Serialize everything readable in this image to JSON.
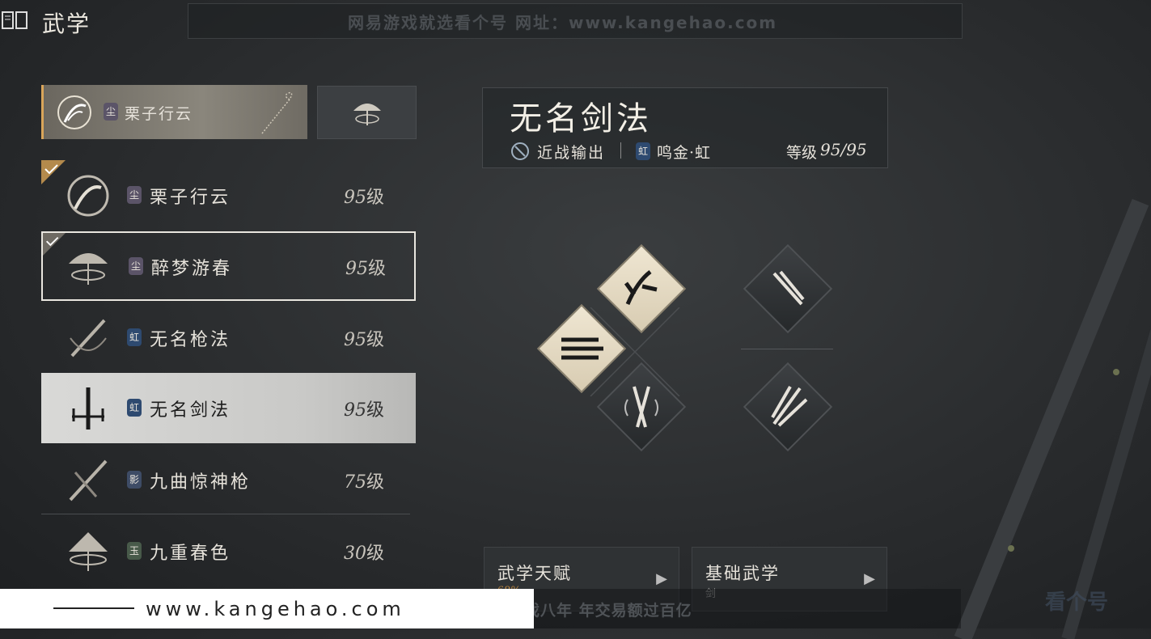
{
  "header": {
    "title": "武学",
    "icon": "book-icon"
  },
  "watermark": {
    "top_banner": "网易游戏就选看个号  网址：www.kangehao.com",
    "footer_url": "www.kangehao.com",
    "footer_text": "看个号专业网易游戏八年  年交易额过百亿",
    "logo_text": "看个号"
  },
  "current_selection": {
    "badge": "尘",
    "name": "栗子行云"
  },
  "list": [
    {
      "badge": "尘",
      "name": "栗子行云",
      "level": "95",
      "level_unit": "级",
      "checked": true,
      "badge_style": "b-chen"
    },
    {
      "badge": "尘",
      "name": "醉梦游春",
      "level": "95",
      "level_unit": "级",
      "checked": true,
      "badge_style": "b-chen"
    },
    {
      "badge": "虹",
      "name": "无名枪法",
      "level": "95",
      "level_unit": "级",
      "checked": false,
      "badge_style": "b-hong"
    },
    {
      "badge": "虹",
      "name": "无名剑法",
      "level": "95",
      "level_unit": "级",
      "checked": false,
      "badge_style": "b-hong"
    },
    {
      "badge": "影",
      "name": "九曲惊神枪",
      "level": "75",
      "level_unit": "级",
      "checked": false,
      "badge_style": "b-ying"
    },
    {
      "badge": "玉",
      "name": "九重春色",
      "level": "30",
      "level_unit": "级",
      "checked": false,
      "badge_style": "b-yu"
    }
  ],
  "detail": {
    "title": "无名剑法",
    "role": "近战输出",
    "badge": "虹",
    "category": "鸣金·虹",
    "level_label": "等级",
    "level_value": "95/95"
  },
  "panels": {
    "talent": {
      "label": "武学天赋",
      "sub": "68%"
    },
    "basic": {
      "label": "基础武学",
      "sub": "剑"
    }
  },
  "colors": {
    "accent": "#d9a55a",
    "bg": "#2a2c2e"
  }
}
